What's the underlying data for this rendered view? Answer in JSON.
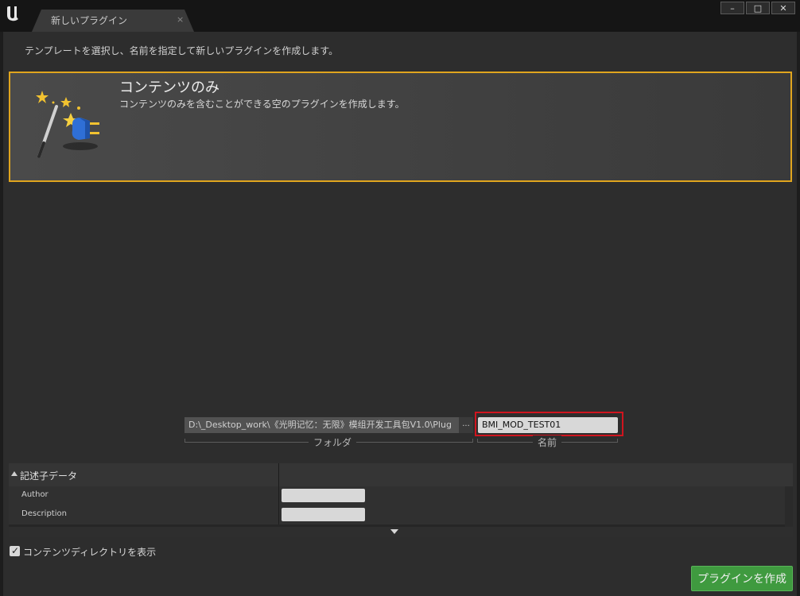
{
  "window": {
    "tab_title": "新しいプラグイン",
    "tab_close": "×",
    "controls": {
      "minimize": "–",
      "maximize": "□",
      "close": "✕"
    }
  },
  "instruction": "テンプレートを選択し、名前を指定して新しいプラグインを作成します。",
  "template": {
    "title": "コンテンツのみ",
    "description": "コンテンツのみを含むことができる空のプラグインを作成します。",
    "icon": "magic-wand-plug-icon",
    "selected": true,
    "accent_color": "#e0a51e"
  },
  "path": {
    "folder_value": "D:\\_Desktop_work\\《光明记忆：无限》模组开发工具包V1.0\\Plug",
    "browse_label": "...",
    "name_value": "BMI_MOD_TEST01",
    "folder_label": "フォルダ",
    "name_label": "名前",
    "highlight_color": "#d0141e"
  },
  "details": {
    "title": "記述子データ",
    "rows": [
      {
        "label": "Author",
        "value": ""
      },
      {
        "label": "Description",
        "value": ""
      }
    ]
  },
  "options": {
    "show_content_dir_label": "コンテンツディレクトリを表示",
    "show_content_dir_checked": true,
    "checkmark": "✓"
  },
  "create_button": {
    "label": "プラグインを作成",
    "color": "#3f9a3f"
  }
}
